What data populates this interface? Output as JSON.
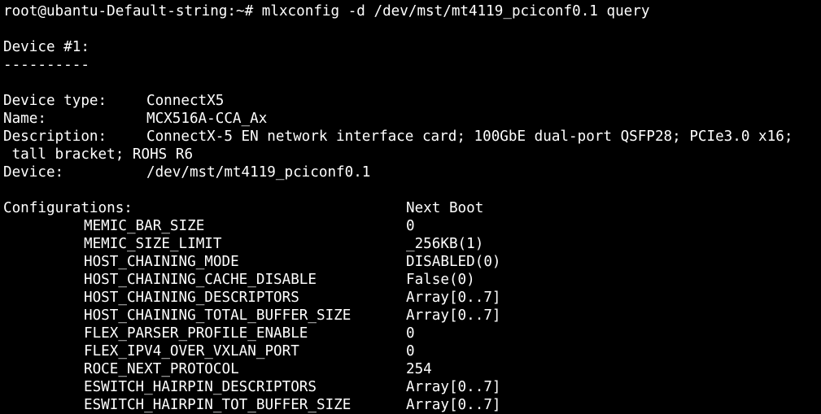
{
  "terminal": {
    "prompt": "root@ubantu-Default-string:~#",
    "command": "mlxconfig -d /dev/mst/mt4119_pciconf0.1 query",
    "device_header": "Device #1:",
    "separator": "----------",
    "info": [
      {
        "key": "Device type:",
        "value": "ConnectX5"
      },
      {
        "key": "Name:",
        "value": "MCX516A-CCA_Ax"
      },
      {
        "key": "Description:",
        "value": "ConnectX-5 EN network interface card; 100GbE dual-port QSFP28; PCIe3.0 x16;"
      },
      {
        "key": "",
        "value": " tall bracket; ROHS R6"
      },
      {
        "key": "Device:",
        "value": "/dev/mst/mt4119_pciconf0.1"
      }
    ],
    "configurations_label": "Configurations:",
    "next_boot_label": "Next Boot",
    "params": [
      {
        "name": "MEMIC_BAR_SIZE",
        "value": "0"
      },
      {
        "name": "MEMIC_SIZE_LIMIT",
        "value": "_256KB(1)"
      },
      {
        "name": "HOST_CHAINING_MODE",
        "value": "DISABLED(0)"
      },
      {
        "name": "HOST_CHAINING_CACHE_DISABLE",
        "value": "False(0)"
      },
      {
        "name": "HOST_CHAINING_DESCRIPTORS",
        "value": "Array[0..7]"
      },
      {
        "name": "HOST_CHAINING_TOTAL_BUFFER_SIZE",
        "value": "Array[0..7]"
      },
      {
        "name": "FLEX_PARSER_PROFILE_ENABLE",
        "value": "0"
      },
      {
        "name": "FLEX_IPV4_OVER_VXLAN_PORT",
        "value": "0"
      },
      {
        "name": "ROCE_NEXT_PROTOCOL",
        "value": "254"
      },
      {
        "name": "ESWITCH_HAIRPIN_DESCRIPTORS",
        "value": "Array[0..7]"
      },
      {
        "name": "ESWITCH_HAIRPIN_TOT_BUFFER_SIZE",
        "value": "Array[0..7]"
      }
    ]
  }
}
